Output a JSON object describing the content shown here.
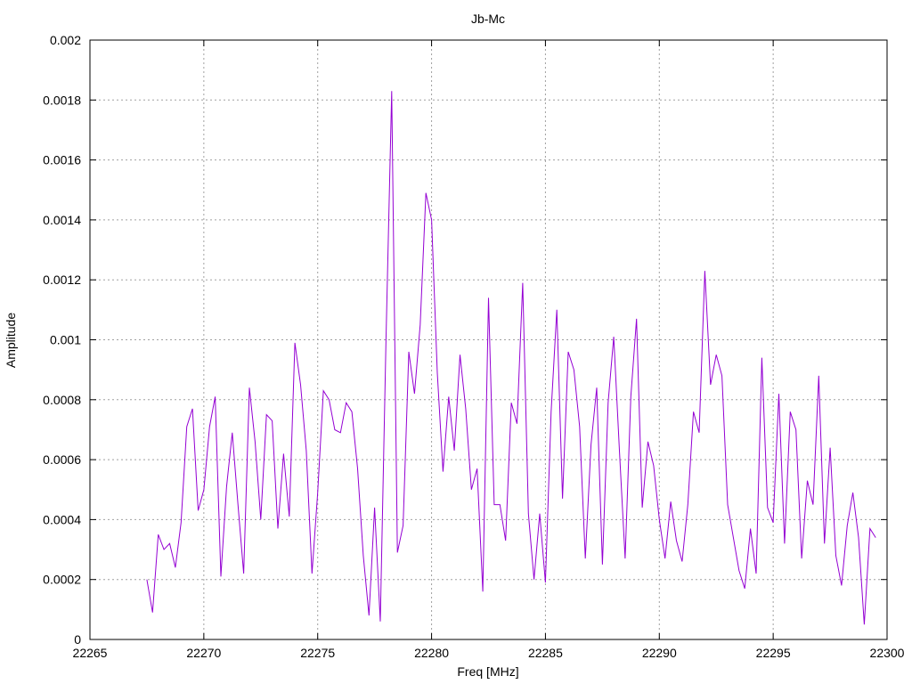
{
  "chart_data": {
    "type": "line",
    "title": "Jb-Mc",
    "xlabel": "Freq [MHz]",
    "ylabel": "Amplitude",
    "xlim": [
      22265,
      22300
    ],
    "ylim": [
      0,
      0.002
    ],
    "grid": true,
    "x_ticks": [
      "22265",
      "22270",
      "22275",
      "22280",
      "22285",
      "22290",
      "22295",
      "22300"
    ],
    "y_ticks": [
      "0",
      "0.0002",
      "0.0004",
      "0.0006",
      "0.0008",
      "0.001",
      "0.0012",
      "0.0014",
      "0.0016",
      "0.0018",
      "0.002"
    ],
    "series": [
      {
        "color": "#9400d3",
        "x": [
          22267.5,
          22267.75,
          22268.0,
          22268.25,
          22268.5,
          22268.75,
          22269.0,
          22269.25,
          22269.5,
          22269.75,
          22270.0,
          22270.25,
          22270.5,
          22270.75,
          22271.0,
          22271.25,
          22271.5,
          22271.75,
          22272.0,
          22272.25,
          22272.5,
          22272.75,
          22273.0,
          22273.25,
          22273.5,
          22273.75,
          22274.0,
          22274.25,
          22274.5,
          22274.75,
          22275.0,
          22275.25,
          22275.5,
          22275.75,
          22276.0,
          22276.25,
          22276.5,
          22276.75,
          22277.0,
          22277.25,
          22277.5,
          22277.75,
          22278.0,
          22278.25,
          22278.5,
          22278.75,
          22279.0,
          22279.25,
          22279.5,
          22279.75,
          22280.0,
          22280.25,
          22280.5,
          22280.75,
          22281.0,
          22281.25,
          22281.5,
          22281.75,
          22282.0,
          22282.25,
          22282.5,
          22282.75,
          22283.0,
          22283.25,
          22283.5,
          22283.75,
          22284.0,
          22284.25,
          22284.5,
          22284.75,
          22285.0,
          22285.25,
          22285.5,
          22285.75,
          22286.0,
          22286.25,
          22286.5,
          22286.75,
          22287.0,
          22287.25,
          22287.5,
          22287.75,
          22288.0,
          22288.25,
          22288.5,
          22288.75,
          22289.0,
          22289.25,
          22289.5,
          22289.75,
          22290.0,
          22290.25,
          22290.5,
          22290.75,
          22291.0,
          22291.25,
          22291.5,
          22291.75,
          22292.0,
          22292.25,
          22292.5,
          22292.75,
          22293.0,
          22293.25,
          22293.5,
          22293.75,
          22294.0,
          22294.25,
          22294.5,
          22294.75,
          22295.0,
          22295.25,
          22295.5,
          22295.75,
          22296.0,
          22296.25,
          22296.5,
          22296.75,
          22297.0,
          22297.25,
          22297.5,
          22297.75,
          22298.0,
          22298.25,
          22298.5,
          22298.75,
          22299.0,
          22299.25,
          22299.5
        ],
        "y": [
          0.0002,
          9e-05,
          0.00035,
          0.0003,
          0.00032,
          0.00024,
          0.00039,
          0.00071,
          0.00077,
          0.00043,
          0.0005,
          0.00071,
          0.00081,
          0.00021,
          0.00051,
          0.00069,
          0.00045,
          0.00022,
          0.00084,
          0.00066,
          0.0004,
          0.00075,
          0.00073,
          0.00037,
          0.00062,
          0.00041,
          0.00099,
          0.00085,
          0.00063,
          0.00022,
          0.00049,
          0.00083,
          0.0008,
          0.0007,
          0.00069,
          0.00079,
          0.00076,
          0.00057,
          0.00028,
          8e-05,
          0.00044,
          6e-05,
          0.001,
          0.00183,
          0.00029,
          0.00038,
          0.00096,
          0.00082,
          0.00105,
          0.00149,
          0.0014,
          0.00089,
          0.00056,
          0.00081,
          0.00063,
          0.00095,
          0.00077,
          0.0005,
          0.00057,
          0.00016,
          0.00114,
          0.00045,
          0.00045,
          0.00033,
          0.00079,
          0.00072,
          0.00119,
          0.00042,
          0.0002,
          0.00042,
          0.00019,
          0.00076,
          0.0011,
          0.00047,
          0.00096,
          0.0009,
          0.00071,
          0.00027,
          0.00065,
          0.00084,
          0.00025,
          0.00079,
          0.00101,
          0.00063,
          0.00027,
          0.00081,
          0.00107,
          0.00044,
          0.00066,
          0.00058,
          0.0004,
          0.00027,
          0.00046,
          0.00033,
          0.00026,
          0.00045,
          0.00076,
          0.00069,
          0.00123,
          0.00085,
          0.00095,
          0.00088,
          0.00045,
          0.00034,
          0.00023,
          0.00017,
          0.00037,
          0.00022,
          0.00094,
          0.00044,
          0.00039,
          0.00082,
          0.00032,
          0.00076,
          0.0007,
          0.00027,
          0.00053,
          0.00045,
          0.00088,
          0.00032,
          0.00064,
          0.00028,
          0.00018,
          0.00038,
          0.00049,
          0.00034,
          5e-05,
          0.00037,
          0.00034
        ]
      }
    ]
  }
}
